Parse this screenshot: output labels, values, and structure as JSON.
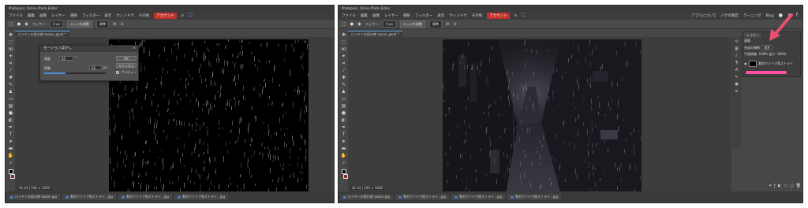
{
  "app": {
    "title": "Photopea | Online Photo Editor"
  },
  "menu": {
    "items": [
      "ファイル",
      "編集",
      "画像",
      "レイヤー",
      "選択",
      "フィルター",
      "表示",
      "ウィンドウ",
      "その他"
    ],
    "account": "アカウント",
    "right_items": [
      "アプリについて",
      "バグの報告",
      "ラーニング",
      "Blog"
    ]
  },
  "options": {
    "feather_label": "フェザー:",
    "feather_value": "0 px",
    "refine_label": "エッジを調整",
    "style_value": "標準",
    "w_label": "W:",
    "h_label": "H:"
  },
  "left": {
    "doc_tab": "ロイヤンの雨の夜 aaaon_good *",
    "zoom": "41.24 | 100 × 1000",
    "dialog": {
      "title": "モーションぼかし",
      "close": "×",
      "angle_label": "角度",
      "angle_value": "85",
      "angle_unit": "°",
      "distance_label": "距離",
      "distance_value": "60",
      "distance_unit": "px",
      "ok": "OK",
      "cancel": "キャンセル",
      "preview_label": "プレビュー",
      "slider_fill": 0.35
    },
    "bottom_tabs": [
      "ロイヤンの雨の夜 aaaon.jpg",
      "素材ファイア雨ストライ...jpg",
      "素材ファイア雨ストライ...jpg",
      "素材ファイア雨ストライ...jpg"
    ]
  },
  "right": {
    "doc_tab": "ロイヤンの雨の夜 aaaon_good *",
    "zoom": "41.24 | 100 × 1000",
    "layers": {
      "tab": "レイヤー",
      "sub_tab": "通路",
      "mode_label": "合成の様態",
      "mode_value": "通常",
      "opacity_label": "不透明度:",
      "opacity_value": "100%",
      "fill_label": "塗り:",
      "fill_value": "100%",
      "layer_name": "素材ファイア雨ストライ",
      "layer_name2": "背景"
    },
    "bottom_tabs": [
      "ロイヤンの雨の夜 aaaon.jpg",
      "素材ファイア雨ストライ...jpg",
      "素材ファイア雨ストライ...jpg",
      "素材ファイア雨ストライ...jpg"
    ]
  },
  "colors": {
    "accent_menu": "#c2312b",
    "highlight": "#ff4fa3",
    "arrow": "#e8506e",
    "slider": "#4f8ee0"
  }
}
